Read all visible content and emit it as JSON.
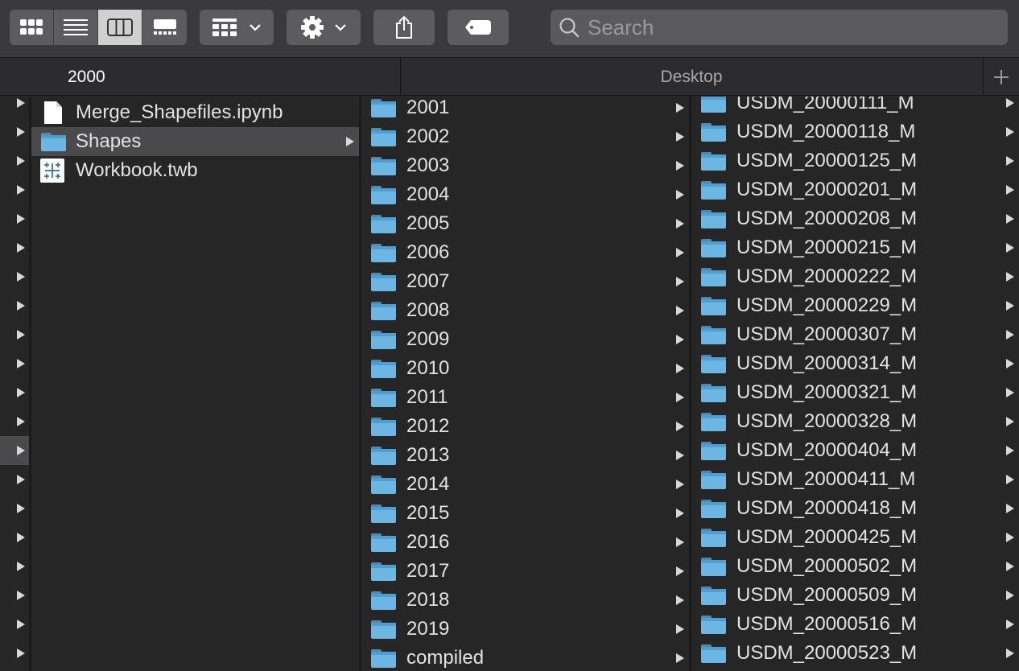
{
  "toolbar": {
    "view_modes": [
      "icon-view",
      "list-view",
      "column-view",
      "gallery-view"
    ],
    "selected_view": "column-view",
    "search_placeholder": "Search"
  },
  "pathbar": {
    "active_tab": "2000",
    "inactive_tab": "Desktop",
    "add_tab": "+"
  },
  "column_left": {
    "items": [
      {
        "name": "Merge_Shapefiles.ipynb",
        "icon": "document-icon"
      },
      {
        "name": "Shapes",
        "icon": "folder-icon",
        "selected": true
      },
      {
        "name": "Workbook.twb",
        "icon": "tableau-workbook-icon"
      }
    ]
  },
  "column_years": {
    "items": [
      "2001",
      "2002",
      "2003",
      "2004",
      "2005",
      "2006",
      "2007",
      "2008",
      "2009",
      "2010",
      "2011",
      "2012",
      "2013",
      "2014",
      "2015",
      "2016",
      "2017",
      "2018",
      "2019",
      "compiled"
    ]
  },
  "column_usdm": {
    "items": [
      "USDM_20000111_M",
      "USDM_20000118_M",
      "USDM_20000125_M",
      "USDM_20000201_M",
      "USDM_20000208_M",
      "USDM_20000215_M",
      "USDM_20000222_M",
      "USDM_20000229_M",
      "USDM_20000307_M",
      "USDM_20000314_M",
      "USDM_20000321_M",
      "USDM_20000328_M",
      "USDM_20000404_M",
      "USDM_20000411_M",
      "USDM_20000418_M",
      "USDM_20000425_M",
      "USDM_20000502_M",
      "USDM_20000509_M",
      "USDM_20000516_M",
      "USDM_20000523_M"
    ]
  },
  "colors": {
    "background": "#262626",
    "toolbar": "#3a3a3c",
    "selection": "#4a4a4c",
    "folder_blue": "#6bb6e2"
  }
}
